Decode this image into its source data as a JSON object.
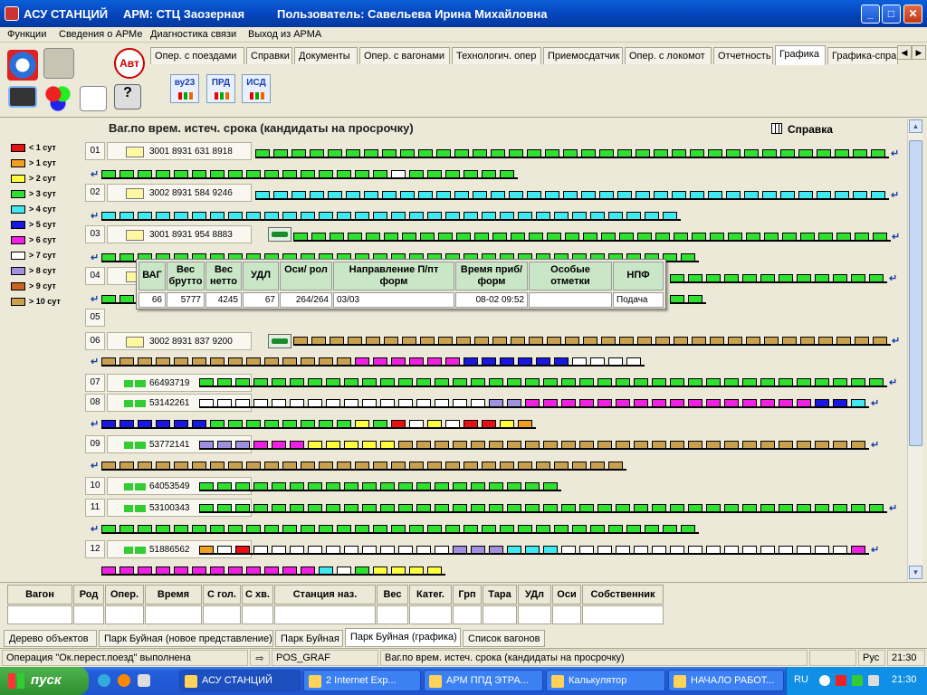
{
  "window": {
    "app": "АСУ СТАНЦИЙ",
    "arm": "АРМ: СТЦ Заозерная",
    "user": "Пользователь: Савельева Ирина Михайловна",
    "minimize": "_",
    "maximize": "□",
    "close": "✕"
  },
  "menu": [
    "Функции",
    "Сведения о АРМе",
    "Диагностика связи",
    "Выход из АРМА"
  ],
  "toolbar": {
    "avt_label": "Авт"
  },
  "tabs": [
    "Опер. с поездами",
    "Справки",
    "Документы",
    "Опер. с вагонами",
    "Технологич. опер",
    "Приемосдатчик",
    "Опер. с локомот",
    "Отчетность",
    "Графика",
    "Графика-спра"
  ],
  "tab_arrows": [
    "◀",
    "▶"
  ],
  "subicons": [
    "ву23",
    "ПРД",
    "ИСД"
  ],
  "content": {
    "title": "Ваг.по врем. истеч. срока (кандидаты на просрочку)",
    "spravka": "Справка",
    "wrap_glyph": "↵"
  },
  "legend": [
    {
      "label": "< 1 сут",
      "color": "#e81010"
    },
    {
      "label": "> 1 сут",
      "color": "#f0a020"
    },
    {
      "label": "> 2 сут",
      "color": "#ffff40"
    },
    {
      "label": "> 3 сут",
      "color": "#30e030"
    },
    {
      "label": "> 4 сут",
      "color": "#40e8f0"
    },
    {
      "label": "> 5 сут",
      "color": "#1818e0"
    },
    {
      "label": "> 6 сут",
      "color": "#f020e0"
    },
    {
      "label": "> 7 сут",
      "color": "#ffffff"
    },
    {
      "label": "> 8 сут",
      "color": "#a090e0"
    },
    {
      "label": "> 9 сут",
      "color": "#c86420"
    },
    {
      "label": "> 10 сут",
      "color": "#c8a050"
    }
  ],
  "rows": [
    {
      "num": "01",
      "label": "3001   8931 631 8918",
      "kind": "doc"
    },
    {
      "num": "02",
      "label": "3002   8931 584 9246",
      "kind": "doc"
    },
    {
      "num": "03",
      "label": "3001   8931 954 8883",
      "kind": "doc"
    },
    {
      "num": "04",
      "label": "",
      "kind": "doc"
    },
    {
      "num": "05",
      "label": "",
      "kind": "none"
    },
    {
      "num": "06",
      "label": "3002   8931 837 9200",
      "kind": "doc"
    },
    {
      "num": "07",
      "label": "66493719",
      "kind": "wag"
    },
    {
      "num": "08",
      "label": "53142261",
      "kind": "wag"
    },
    {
      "num": "09",
      "label": "53772141",
      "kind": "wag"
    },
    {
      "num": "10",
      "label": "64053549",
      "kind": "wag"
    },
    {
      "num": "11",
      "label": "53100343",
      "kind": "wag"
    },
    {
      "num": "12",
      "label": "51886562",
      "kind": "wag"
    }
  ],
  "popup": {
    "headers": [
      "ВАГ",
      "Вес брутто",
      "Вес нетто",
      "УДЛ",
      "Оси/ рол",
      "Направление П/пт форм",
      "Время приб/форм",
      "Особые отметки",
      "НПФ"
    ],
    "values": [
      "66",
      "5777",
      "4245",
      "67",
      "264/264",
      "03/03",
      "08-02 09:52",
      "",
      "Подача"
    ]
  },
  "scroll": {
    "up": "▲",
    "down": "▼"
  },
  "bottom_grid": {
    "headers": [
      "Вагон",
      "Род",
      "Опер.",
      "Время",
      "С гол.",
      "С хв.",
      "Станция наз.",
      "Вес",
      "Катег.",
      "Грп",
      "Тара",
      "УДл",
      "Оси",
      "Собственник"
    ]
  },
  "bottom_tabs": [
    "Дерево объектов",
    "Парк Буйная (новое представление)",
    "Парк Буйная",
    "Парк Буйная (графика)",
    "Список вагонов"
  ],
  "status": {
    "message": "Операция \"Ок.перест.поезд\" выполнена",
    "arrow": "⇨",
    "code": "POS_GRAF",
    "caption": "Ваг.по врем. истеч. срока (кандидаты на просрочку)",
    "lang": "Рус",
    "time": "21:30"
  },
  "taskbar": {
    "start": "пуск",
    "buttons": [
      "АСУ СТАНЦИЙ",
      "2 Internet Exp...",
      "АРМ ППД ЭТРА...",
      "Калькулятор",
      "НАЧАЛО РАБОТ..."
    ],
    "lang": "RU",
    "time": "21:30"
  }
}
